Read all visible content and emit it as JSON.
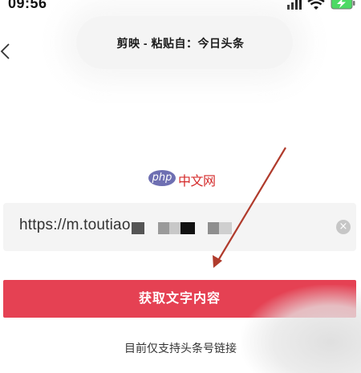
{
  "status_bar": {
    "time": "09:56"
  },
  "toast": {
    "text": "剪映 - 粘贴自：今日头条"
  },
  "nav": {
    "back_icon": "chevron-left-icon"
  },
  "watermark": {
    "logo_text": "php",
    "site_text": "中文网"
  },
  "url_input": {
    "value": "https://m.toutiao.",
    "clear_icon": "clear-circle-icon"
  },
  "fetch_button": {
    "label": "获取文字内容"
  },
  "hint": {
    "text": "目前仅支持头条号链接"
  },
  "colors": {
    "accent": "#e54153",
    "annotation_arrow": "#b03b2c",
    "watermark_red": "#d42a2a",
    "watermark_logo": "#6e6fb2"
  }
}
